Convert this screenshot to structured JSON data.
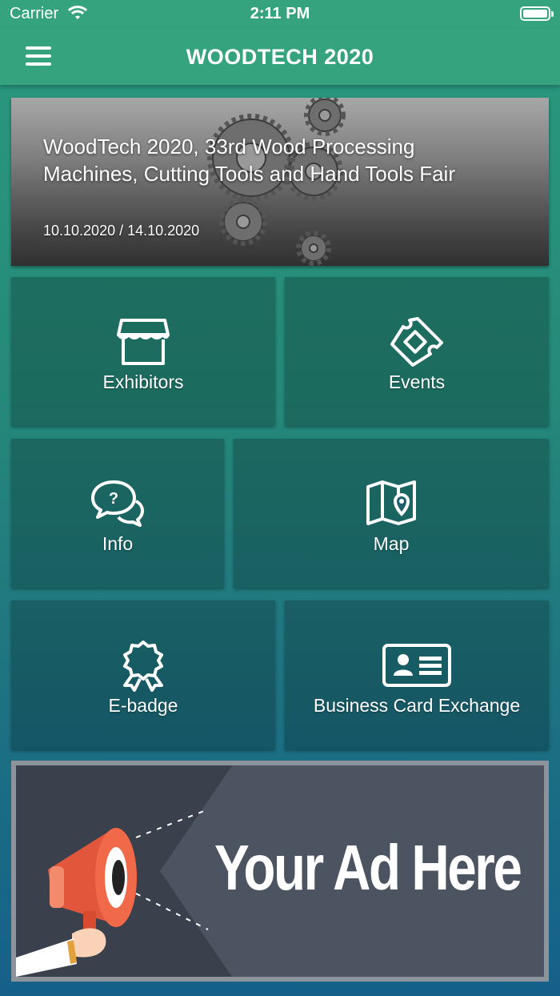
{
  "status": {
    "carrier": "Carrier",
    "time": "2:11 PM"
  },
  "nav": {
    "title": "WOODTECH 2020",
    "menu_icon": "hamburger-icon"
  },
  "hero": {
    "title": "WoodTech 2020, 33rd Wood Processing Machines, Cutting Tools and Hand Tools Fair",
    "date": "10.10.2020 / 14.10.2020"
  },
  "tiles": [
    {
      "label": "Exhibitors",
      "icon": "store-icon"
    },
    {
      "label": "Events",
      "icon": "ticket-icon"
    },
    {
      "label": "Info",
      "icon": "question-chat-icon"
    },
    {
      "label": "Map",
      "icon": "map-pin-icon"
    },
    {
      "label": "E-badge",
      "icon": "badge-icon"
    },
    {
      "label": "Business Card Exchange",
      "icon": "id-card-icon"
    }
  ],
  "ad": {
    "text": "Your Ad Here",
    "icon": "megaphone-icon"
  },
  "colors": {
    "bar": "#35a47e",
    "bg_top": "#2a9a7c",
    "bg_bottom": "#15608a"
  }
}
